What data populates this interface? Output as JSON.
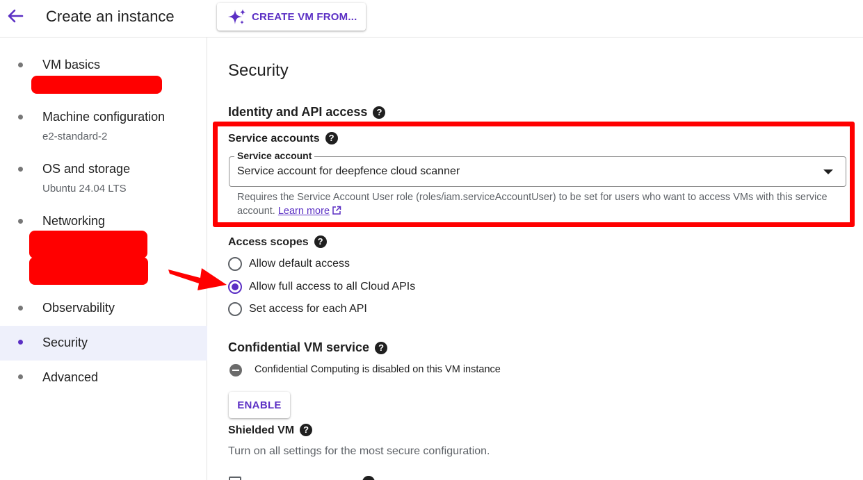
{
  "header": {
    "title": "Create an instance",
    "create_from_label": "CREATE VM FROM..."
  },
  "sidebar": {
    "items": [
      {
        "label": "VM basics",
        "sub": ""
      },
      {
        "label": "Machine configuration",
        "sub": "e2-standard-2"
      },
      {
        "label": "OS and storage",
        "sub": "Ubuntu 24.04 LTS"
      },
      {
        "label": "Networking",
        "sub": ""
      },
      {
        "label": "Observability",
        "sub": ""
      },
      {
        "label": "Security",
        "sub": ""
      },
      {
        "label": "Advanced",
        "sub": ""
      }
    ],
    "active_item": "Security"
  },
  "main": {
    "heading": "Security",
    "identity": {
      "title": "Identity and API access",
      "service_accounts_label": "Service accounts",
      "service_account_field_label": "Service account",
      "service_account_value": "Service account for deepfence cloud scanner",
      "hint_text": "Requires the Service Account User role (roles/iam.serviceAccountUser) to be set for users who want to access VMs with this service account.",
      "learn_more": "Learn more"
    },
    "access_scopes": {
      "label": "Access scopes",
      "options": [
        {
          "label": "Allow default access",
          "selected": false
        },
        {
          "label": "Allow full access to all Cloud APIs",
          "selected": true
        },
        {
          "label": "Set access for each API",
          "selected": false
        }
      ]
    },
    "confidential": {
      "title": "Confidential VM service",
      "status": "Confidential Computing is disabled on this VM instance",
      "enable_label": "ENABLE"
    },
    "shielded": {
      "title": "Shielded VM",
      "description": "Turn on all settings for the most secure configuration."
    }
  },
  "colors": {
    "accent": "#5b2fc4",
    "annotation_red": "#ff0000",
    "active_nav_bg": "#eef0fb"
  },
  "icons": {
    "back": "arrow-back-icon",
    "create_from": "sparkle-icon",
    "help": "help-circle-icon",
    "dropdown": "caret-down-icon",
    "external": "open-in-new-icon",
    "status": "minus-circle-icon",
    "annotation": "red-arrow-icon"
  }
}
